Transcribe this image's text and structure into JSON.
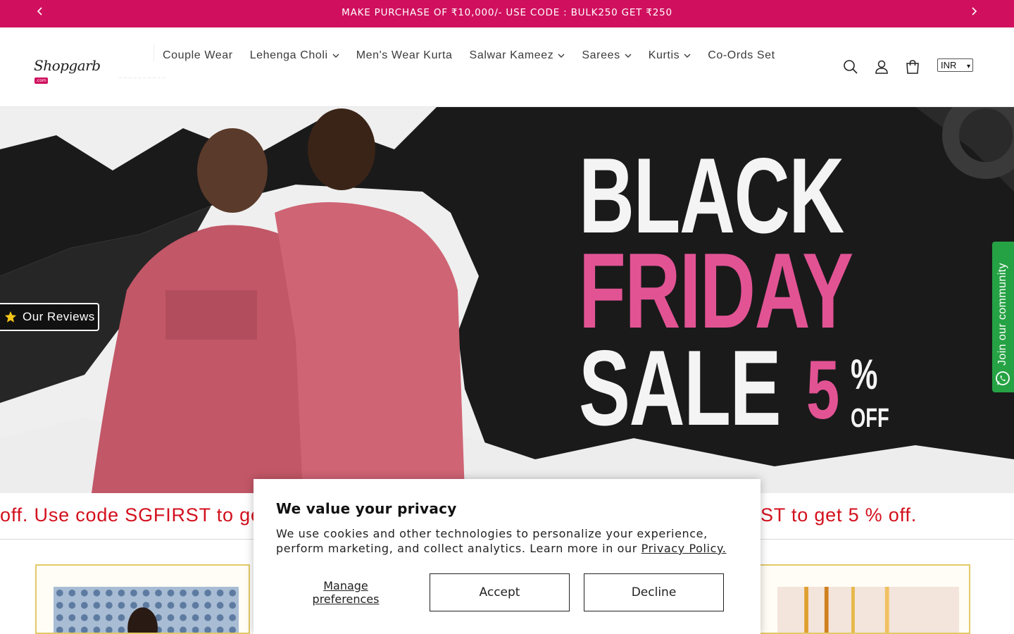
{
  "announcement": {
    "message": "MAKE PURCHASE OF ₹10,000/- USE CODE : BULK250 GET ₹250",
    "prev_icon": "chevron-left-icon",
    "next_icon": "chevron-right-icon"
  },
  "header": {
    "logo_text": "Shopgarb",
    "logo_badge": ".com",
    "nav": [
      {
        "label": "Couple Wear",
        "has_dropdown": false
      },
      {
        "label": "Lehenga Choli",
        "has_dropdown": true
      },
      {
        "label": "Men's Wear Kurta",
        "has_dropdown": false
      },
      {
        "label": "Salwar Kameez",
        "has_dropdown": true
      },
      {
        "label": "Sarees",
        "has_dropdown": true
      },
      {
        "label": "Kurtis",
        "has_dropdown": true
      },
      {
        "label": "Co-Ords Set",
        "has_dropdown": false
      }
    ],
    "icons": [
      "search-icon",
      "account-icon",
      "cart-icon"
    ],
    "currency": "INR"
  },
  "hero": {
    "line1": "BLACK",
    "line2": "FRIDAY",
    "line3": "SALE",
    "percent": "5",
    "percent_symbol": "%",
    "off": "OFF",
    "accent_color": "#e25394"
  },
  "reviews_tab": {
    "label": "Our Reviews",
    "icon": "star-icon"
  },
  "community_tab": {
    "label": "Join our community",
    "icon": "whatsapp-icon"
  },
  "marquee": {
    "left_text": "off. Use code SGFIRST to get",
    "right_text": "ST to get 5 % off."
  },
  "cookie": {
    "title": "We value your privacy",
    "body_line1": "We use cookies and other technologies to personalize your experience,",
    "body_line2": "perform marketing, and collect analytics. Learn more in our ",
    "policy_link": "Privacy Policy.",
    "manage_line1": "Manage",
    "manage_line2": "preferences",
    "accept": "Accept",
    "decline": "Decline"
  },
  "colors": {
    "brand": "#d0105e",
    "marquee_text": "#d3101d",
    "community": "#25a244"
  }
}
